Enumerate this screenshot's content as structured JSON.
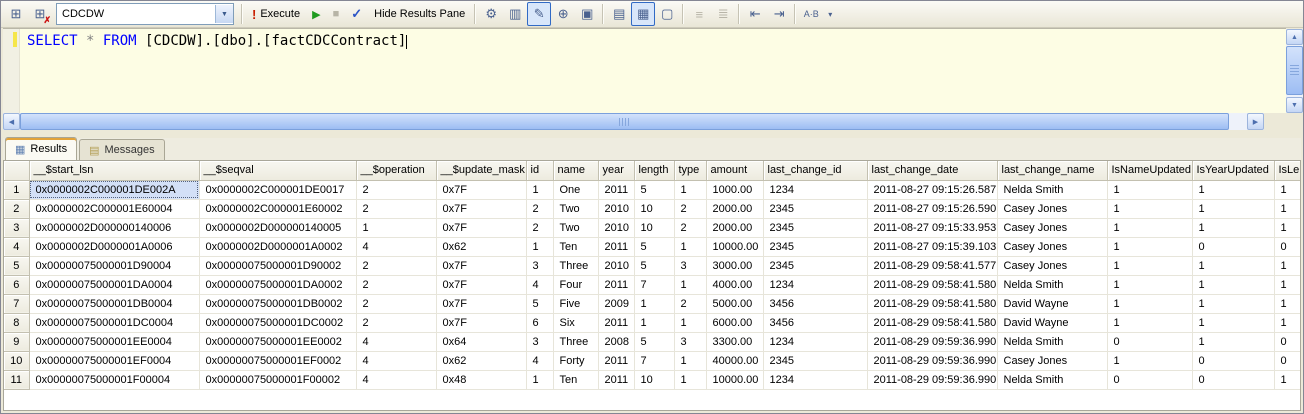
{
  "toolbar": {
    "left_icons": [
      {
        "name": "connect-icon",
        "glyph": "⊞"
      },
      {
        "name": "change-connection-icon",
        "glyph": "⊞",
        "badge": "✗"
      }
    ],
    "database_combo": {
      "value": "CDCDW",
      "dropdown_glyph": "▼"
    },
    "execute_button": {
      "bang": "!",
      "label": "Execute"
    },
    "debug_button": {
      "glyph": "▶"
    },
    "stop_button": {
      "glyph": "■"
    },
    "parse_button": {
      "glyph": "✓"
    },
    "hide_results_button": {
      "label": "Hide Results Pane"
    },
    "right_icons": [
      {
        "name": "display-estimated-plan-icon",
        "glyph": "⚙"
      },
      {
        "name": "query-options-icon",
        "glyph": "▥"
      },
      {
        "name": "intellisense-enabled-icon",
        "glyph": "✎",
        "state": "pressed"
      },
      {
        "name": "include-actual-plan-icon",
        "glyph": "⊕"
      },
      {
        "name": "include-client-statistics-icon",
        "glyph": "▣"
      },
      {
        "separator": true
      },
      {
        "name": "results-to-text-icon",
        "glyph": "▤"
      },
      {
        "name": "results-to-grid-icon",
        "glyph": "▦",
        "state": "pressed"
      },
      {
        "name": "results-to-file-icon",
        "glyph": "▢"
      },
      {
        "separator": true
      },
      {
        "name": "comment-out-icon",
        "glyph": "≡",
        "state": "disabled"
      },
      {
        "name": "uncomment-icon",
        "glyph": "≣",
        "state": "disabled"
      },
      {
        "separator": true
      },
      {
        "name": "decrease-indent-icon",
        "glyph": "⇤"
      },
      {
        "name": "increase-indent-icon",
        "glyph": "⇥"
      },
      {
        "separator": true
      },
      {
        "name": "template-parameters-icon",
        "glyph": "A·B"
      }
    ],
    "overflow_chevron": "▾"
  },
  "editor": {
    "query_tokens": [
      {
        "text": "SELECT ",
        "type": "keyword"
      },
      {
        "text": "* ",
        "type": "operator"
      },
      {
        "text": "FROM ",
        "type": "keyword"
      },
      {
        "text": "[CDCDW].[dbo].[factCDCContract]",
        "type": "plain"
      }
    ]
  },
  "results_pane": {
    "tabs": [
      {
        "label": "Results",
        "icon": "results-grid-icon",
        "active": true
      },
      {
        "label": "Messages",
        "icon": "messages-icon",
        "active": false
      }
    ],
    "grid": {
      "headers": [
        "__$start_lsn",
        "__$seqval",
        "__$operation",
        "__$update_mask",
        "id",
        "name",
        "year",
        "length",
        "type",
        "amount",
        "last_change_id",
        "last_change_date",
        "last_change_name",
        "IsNameUpdated",
        "IsYearUpdated",
        "IsLe"
      ],
      "rows": [
        [
          "0x0000002C000001DE002A",
          "0x0000002C000001DE0017",
          "2",
          "0x7F",
          "1",
          "One",
          "2011",
          "5",
          "1",
          "1000.00",
          "1234",
          "2011-08-27 09:15:26.587",
          "Nelda Smith",
          "1",
          "1",
          "1"
        ],
        [
          "0x0000002C000001E60004",
          "0x0000002C000001E60002",
          "2",
          "0x7F",
          "2",
          "Two",
          "2010",
          "10",
          "2",
          "2000.00",
          "2345",
          "2011-08-27 09:15:26.590",
          "Casey Jones",
          "1",
          "1",
          "1"
        ],
        [
          "0x0000002D000000140006",
          "0x0000002D000000140005",
          "1",
          "0x7F",
          "2",
          "Two",
          "2010",
          "10",
          "2",
          "2000.00",
          "2345",
          "2011-08-27 09:15:33.953",
          "Casey Jones",
          "1",
          "1",
          "1"
        ],
        [
          "0x0000002D0000001A0006",
          "0x0000002D0000001A0002",
          "4",
          "0x62",
          "1",
          "Ten",
          "2011",
          "5",
          "1",
          "10000.00",
          "2345",
          "2011-08-27 09:15:39.103",
          "Casey Jones",
          "1",
          "0",
          "0"
        ],
        [
          "0x00000075000001D90004",
          "0x00000075000001D90002",
          "2",
          "0x7F",
          "3",
          "Three",
          "2010",
          "5",
          "3",
          "3000.00",
          "2345",
          "2011-08-29 09:58:41.577",
          "Casey Jones",
          "1",
          "1",
          "1"
        ],
        [
          "0x00000075000001DA0004",
          "0x00000075000001DA0002",
          "2",
          "0x7F",
          "4",
          "Four",
          "2011",
          "7",
          "1",
          "4000.00",
          "1234",
          "2011-08-29 09:58:41.580",
          "Nelda Smith",
          "1",
          "1",
          "1"
        ],
        [
          "0x00000075000001DB0004",
          "0x00000075000001DB0002",
          "2",
          "0x7F",
          "5",
          "Five",
          "2009",
          "1",
          "2",
          "5000.00",
          "3456",
          "2011-08-29 09:58:41.580",
          "David Wayne",
          "1",
          "1",
          "1"
        ],
        [
          "0x00000075000001DC0004",
          "0x00000075000001DC0002",
          "2",
          "0x7F",
          "6",
          "Six",
          "2011",
          "1",
          "1",
          "6000.00",
          "3456",
          "2011-08-29 09:58:41.580",
          "David Wayne",
          "1",
          "1",
          "1"
        ],
        [
          "0x00000075000001EE0004",
          "0x00000075000001EE0002",
          "4",
          "0x64",
          "3",
          "Three",
          "2008",
          "5",
          "3",
          "3300.00",
          "1234",
          "2011-08-29 09:59:36.990",
          "Nelda Smith",
          "0",
          "1",
          "0"
        ],
        [
          "0x00000075000001EF0004",
          "0x00000075000001EF0002",
          "4",
          "0x62",
          "4",
          "Forty",
          "2011",
          "7",
          "1",
          "40000.00",
          "2345",
          "2011-08-29 09:59:36.990",
          "Casey Jones",
          "1",
          "0",
          "0"
        ],
        [
          "0x00000075000001F00004",
          "0x00000075000001F00002",
          "4",
          "0x48",
          "1",
          "Ten",
          "2011",
          "10",
          "1",
          "10000.00",
          "1234",
          "2011-08-29 09:59:36.990",
          "Nelda Smith",
          "0",
          "0",
          "1"
        ]
      ],
      "selection": {
        "row_index": 0,
        "col_index": 0
      }
    }
  },
  "colors": {
    "editor_background": "#fdfde4",
    "keyword_blue": "#0000ff",
    "operator_gray": "#808080",
    "selected_cell_blue": "#d3e0f7",
    "pressed_button_border": "#316ac5",
    "active_tab_accent": "#e2a33b"
  }
}
